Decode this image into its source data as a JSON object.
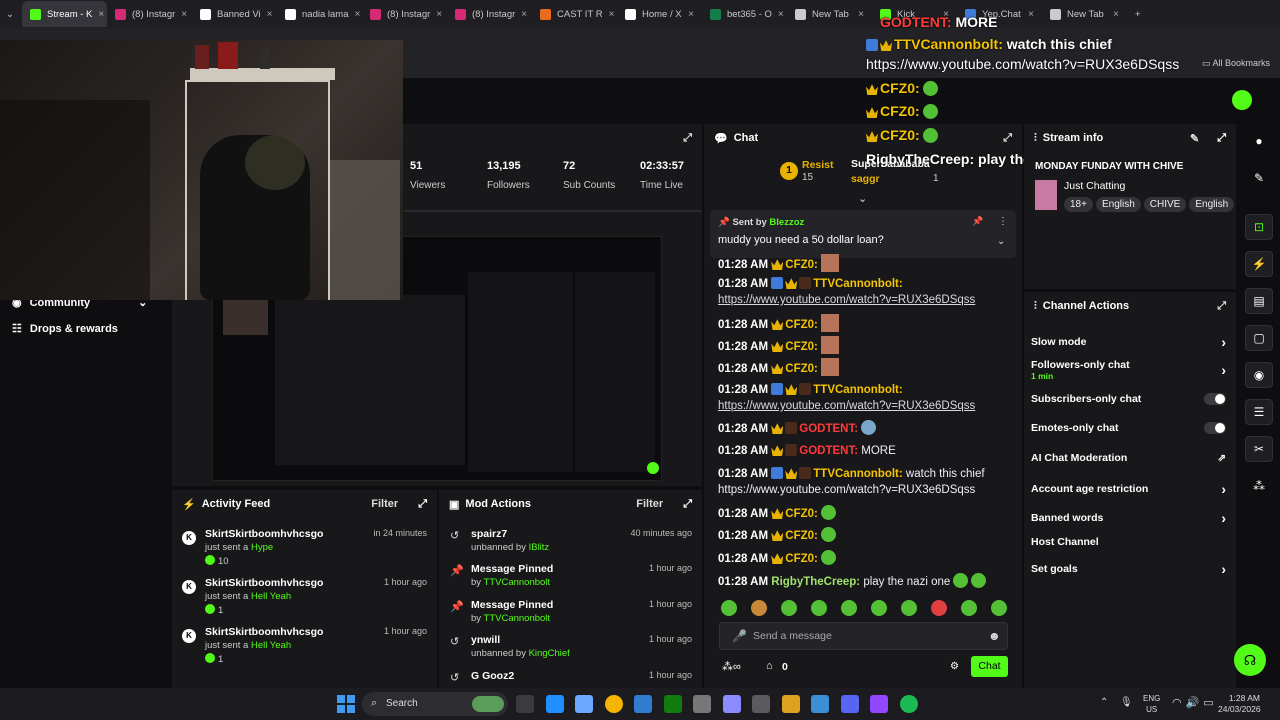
{
  "browser": {
    "tabs": [
      {
        "label": "Stream - K",
        "color": "#53fc18",
        "active": true
      },
      {
        "label": "(8) Instagr",
        "color": "#d62976"
      },
      {
        "label": "Banned Vi",
        "color": "#ffffff"
      },
      {
        "label": "nadia lama",
        "color": "#ffffff"
      },
      {
        "label": "(8) Instagr",
        "color": "#d62976"
      },
      {
        "label": "(8) Instagr",
        "color": "#d62976"
      },
      {
        "label": "CAST IT R",
        "color": "#e96c1f"
      },
      {
        "label": "Home / X",
        "color": "#ffffff"
      },
      {
        "label": "bet365 - O",
        "color": "#127f4a"
      },
      {
        "label": "New Tab",
        "color": "#cccccc"
      },
      {
        "label": "Kick",
        "color": "#53fc18"
      },
      {
        "label": "Yep.Chat",
        "color": "#3f7bd9"
      },
      {
        "label": "New Tab",
        "color": "#cccccc"
      }
    ],
    "all_bookmarks": "All Bookmarks"
  },
  "overlay_chat": {
    "line1_user": "GODTENT:",
    "line1_msg": "MORE",
    "line2_user": "TTVCannonbolt:",
    "line2_msg": "watch this chief",
    "line3": "https://www.youtube.com/watch?v=RUX3e6DSqss",
    "cfz": "CFZ0:",
    "rigby_user": "RigbyTheCreep:",
    "rigby_msg": "play the nazi one"
  },
  "stats": [
    {
      "value": "51",
      "label": "Viewers"
    },
    {
      "value": "13,195",
      "label": "Followers"
    },
    {
      "value": "72",
      "label": "Sub Counts"
    },
    {
      "value": "02:33:57",
      "label": "Time Live"
    }
  ],
  "sidebar": {
    "community": "Community",
    "drops": "Drops & rewards"
  },
  "chat": {
    "title": "Chat",
    "top_gifter": {
      "rank": "1",
      "name1": "Resist",
      "count1": "15",
      "name2": "Superbabababa",
      "name3": "saggr",
      "count3": "1"
    },
    "pinned": {
      "sent_by_label": "Sent by",
      "sender": "Blezzoz",
      "message": "muddy you need a 50 dollar loan?"
    },
    "messages": [
      {
        "time": "01:28 AM",
        "user": "CFZ0:",
        "kind": "cfz",
        "text": ""
      },
      {
        "time": "01:28 AM",
        "user": "TTVCannonbolt:",
        "kind": "ttv",
        "text": "https://www.youtube.com/watch?v=RUX3e6DSqss"
      },
      {
        "time": "01:28 AM",
        "user": "CFZ0:",
        "kind": "cfz",
        "text": ""
      },
      {
        "time": "01:28 AM",
        "user": "CFZ0:",
        "kind": "cfz",
        "text": ""
      },
      {
        "time": "01:28 AM",
        "user": "CFZ0:",
        "kind": "cfz",
        "text": ""
      },
      {
        "time": "01:28 AM",
        "user": "TTVCannonbolt:",
        "kind": "ttv",
        "text": "https://www.youtube.com/watch?v=RUX3e6DSqss"
      },
      {
        "time": "01:28 AM",
        "user": "GODTENT:",
        "kind": "god",
        "text": ""
      },
      {
        "time": "01:28 AM",
        "user": "GODTENT:",
        "kind": "god",
        "text": "MORE"
      },
      {
        "time": "01:28 AM",
        "user": "TTVCannonbolt:",
        "kind": "ttv",
        "text": "watch this chief https://www.youtube.com/watch?v=RUX3e6DSqss"
      },
      {
        "time": "01:28 AM",
        "user": "CFZ0:",
        "kind": "cfz",
        "text": ""
      },
      {
        "time": "01:28 AM",
        "user": "CFZ0:",
        "kind": "cfz",
        "text": ""
      },
      {
        "time": "01:28 AM",
        "user": "CFZ0:",
        "kind": "cfz",
        "text": ""
      },
      {
        "time": "01:28 AM",
        "user": "RigbyTheCreep:",
        "kind": "rig",
        "text": "play the nazi one"
      }
    ],
    "input_placeholder": "Send a message",
    "points": "0",
    "send_label": "Chat"
  },
  "stream_info": {
    "title": "Stream info",
    "stream_title": "MONDAY FUNDAY WITH CHIVE",
    "category": "Just Chatting",
    "tags": [
      "18+",
      "English",
      "CHIVE",
      "English"
    ]
  },
  "channel_actions": {
    "title": "Channel Actions",
    "slow_mode": "Slow mode",
    "followers_only": "Followers-only chat",
    "followers_only_sub": "1 min",
    "subscribers_only": "Subscribers-only chat",
    "emotes_only": "Emotes-only chat",
    "ai_moderation": "AI Chat Moderation",
    "account_age": "Account age restriction",
    "banned_words": "Banned words",
    "host_channel": "Host Channel",
    "set_goals": "Set goals"
  },
  "activity_feed": {
    "title": "Activity Feed",
    "filter": "Filter",
    "items": [
      {
        "user": "SkirtSkirtboomhvhcsgo",
        "action": "just sent a",
        "gift": "Hype",
        "amount": "10",
        "time": "in 24 minutes"
      },
      {
        "user": "SkirtSkirtboomhvhcsgo",
        "action": "just sent a",
        "gift": "Hell Yeah",
        "amount": "1",
        "time": "1 hour ago"
      },
      {
        "user": "SkirtSkirtboomhvhcsgo",
        "action": "just sent a",
        "gift": "Hell Yeah",
        "amount": "1",
        "time": "1 hour ago"
      }
    ]
  },
  "mod_actions": {
    "title": "Mod Actions",
    "filter": "Filter",
    "items": [
      {
        "title": "spairz7",
        "sub": "unbanned by",
        "by": "IBlitz",
        "time": "40 minutes ago",
        "icon": "undo-icon"
      },
      {
        "title": "Message Pinned",
        "sub": "by",
        "by": "TTVCannonbolt",
        "time": "1 hour ago",
        "icon": "pin-icon"
      },
      {
        "title": "Message Pinned",
        "sub": "by",
        "by": "TTVCannonbolt",
        "time": "1 hour ago",
        "icon": "pin-icon"
      },
      {
        "title": "ynwill",
        "sub": "unbanned by",
        "by": "KingChief",
        "time": "1 hour ago",
        "icon": "undo-icon"
      },
      {
        "title": "G Gooz2",
        "sub": "",
        "by": "",
        "time": "1 hour ago",
        "icon": "undo-icon"
      }
    ]
  },
  "taskbar": {
    "search": "Search",
    "lang1": "ENG",
    "lang2": "US",
    "time": "1:28 AM",
    "date": "24/03/2026"
  },
  "colors": {
    "kick_green": "#53fc18",
    "panel": "#18181b",
    "bg": "#0e0e10",
    "crown": "#f5c400"
  }
}
